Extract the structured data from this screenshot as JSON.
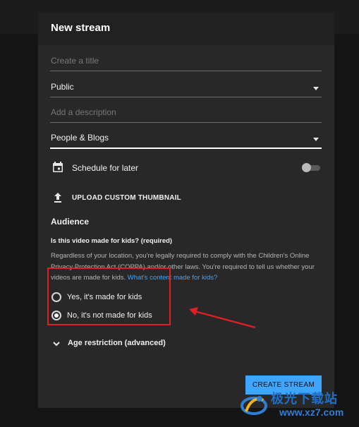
{
  "dialog": {
    "title": "New stream",
    "title_field": {
      "placeholder": "Create a title"
    },
    "visibility": {
      "value": "Public"
    },
    "description_field": {
      "placeholder": "Add a description"
    },
    "category": {
      "value": "People & Blogs"
    },
    "schedule": {
      "label": "Schedule for later",
      "enabled": false
    },
    "upload_thumbnail": {
      "label": "UPLOAD CUSTOM THUMBNAIL"
    },
    "audience": {
      "heading": "Audience",
      "question": "Is this video made for kids? (required)",
      "description": "Regardless of your location, you're legally required to comply with the Children's Online Privacy Protection Act (COPPA) and/or other laws. You're required to tell us whether your videos are made for kids. ",
      "link": "What's content made for kids?",
      "options": [
        {
          "label": "Yes, it's made for kids",
          "selected": false
        },
        {
          "label": "No, it's not made for kids",
          "selected": true
        }
      ]
    },
    "age_restriction": {
      "label": "Age restriction (advanced)"
    },
    "create_button": {
      "label": "CREATE STREAM"
    }
  },
  "watermark": {
    "brand": "极光下载站",
    "url": "www.xz7.com"
  },
  "colors": {
    "accent": "#3ea6ff",
    "annotation": "#e01e24",
    "dialog_bg": "#282828",
    "page_bg": "#141414"
  },
  "icons": [
    "calendar-icon",
    "upload-icon",
    "chevron-down-icon",
    "dropdown-caret-icon"
  ]
}
